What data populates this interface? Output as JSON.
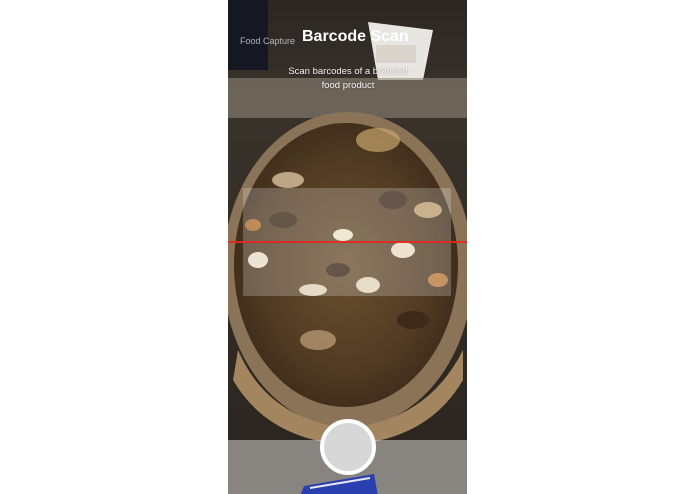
{
  "header": {
    "back_label": "Food Capture",
    "title": "Barcode Scan",
    "instruction": "Scan barcodes of a branded food product"
  },
  "scanner": {
    "scan_line_color": "#e8261f"
  },
  "capture": {
    "shutter_icon": "circle-shutter-icon"
  }
}
